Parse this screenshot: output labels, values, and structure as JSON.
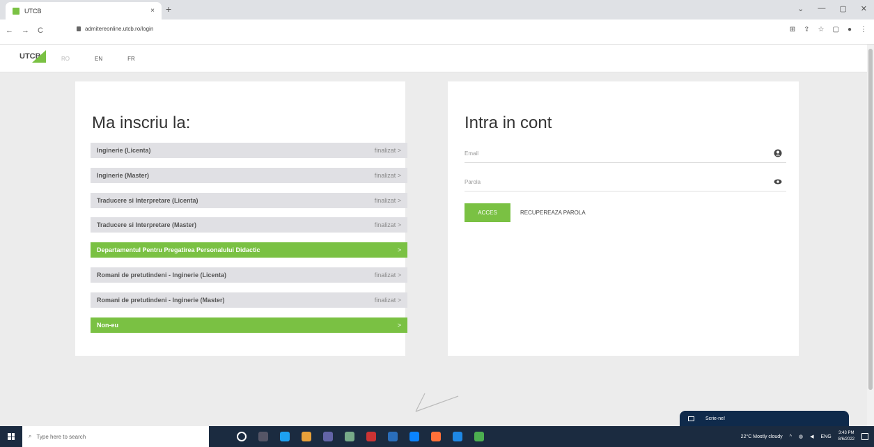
{
  "browser": {
    "tab_title": "UTCB",
    "tab_close": "×",
    "new_tab": "+",
    "url": "admitereonline.utcb.ro/login",
    "window_controls": [
      "⌄",
      "—",
      "▢",
      "✕"
    ],
    "nav": [
      "←",
      "→",
      "C"
    ],
    "ext_icons": [
      "⊞",
      "⇪",
      "☆",
      "▢",
      "●",
      "⋮"
    ]
  },
  "site": {
    "logo_text": "UTCB",
    "languages": [
      "RO",
      "EN",
      "FR"
    ]
  },
  "left_card": {
    "title": "Ma inscriu la:",
    "programs": [
      {
        "label": "Inginerie (Licenta)",
        "status": "finalizat >",
        "active": false
      },
      {
        "label": "Inginerie (Master)",
        "status": "finalizat >",
        "active": false
      },
      {
        "label": "Traducere si Interpretare (Licenta)",
        "status": "finalizat >",
        "active": false
      },
      {
        "label": "Traducere si Interpretare (Master)",
        "status": "finalizat >",
        "active": false
      },
      {
        "label": "Departamentul Pentru Pregatirea Personalului Didactic",
        "status": ">",
        "active": true
      },
      {
        "label": "Romani de pretutindeni - Inginerie (Licenta)",
        "status": "finalizat >",
        "active": false
      },
      {
        "label": "Romani de pretutindeni - Inginerie (Master)",
        "status": "finalizat >",
        "active": false
      },
      {
        "label": "Non-eu",
        "status": ">",
        "active": true
      }
    ]
  },
  "right_card": {
    "title": "Intra in cont",
    "email_placeholder": "Email",
    "password_placeholder": "Parola",
    "acces_button": "ACCES",
    "recover_link": "RECUPEREAZA PAROLA"
  },
  "chat": {
    "label": "Scrie-ne!"
  },
  "taskbar": {
    "search_placeholder": "Type here to search",
    "weather": "22°C  Mostly cloudy",
    "lang": "ENG",
    "time": "3:43 PM",
    "date": "8/6/2022"
  },
  "colors": {
    "accent": "#7ac143",
    "taskbar": "#1b2b40",
    "chat": "#0f2a4b"
  }
}
